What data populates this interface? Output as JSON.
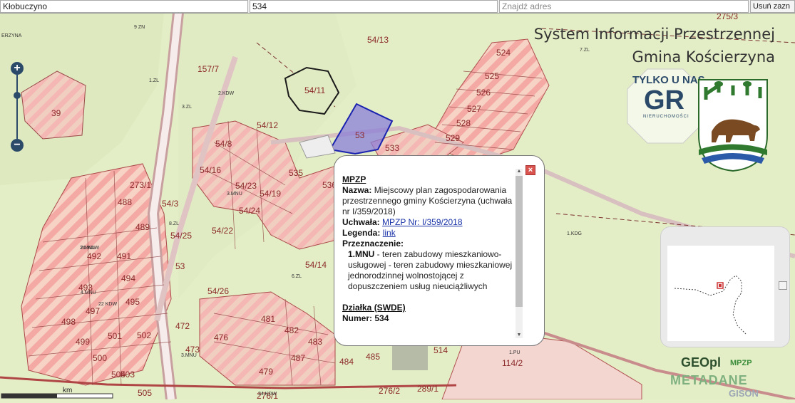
{
  "topbar": {
    "place_value": "Kłobuczyno",
    "number_value": "534",
    "address_placeholder": "Znajdź adres",
    "clear_label": "Usuń zazn"
  },
  "header": {
    "title_line1": "System Informacji Przestrzennej",
    "title_line2": "Gmina Kościerzyna"
  },
  "zoom": {
    "in": "+",
    "out": "−"
  },
  "badge": {
    "top": "TYLKO U NAS",
    "big": "GR",
    "sub": "NIERUCHOMOŚCI"
  },
  "popup": {
    "heading": "MPZP",
    "name_label": "Nazwa:",
    "name_value": "Miejscowy plan zagospodarowania przestrzennego gminy Kościerzyna (uchwała nr I/359/2018)",
    "resolution_label": "Uchwała:",
    "resolution_link": "MPZP Nr: I/359/2018",
    "legend_label": "Legenda:",
    "legend_link": "link",
    "purpose_label": "Przeznaczenie:",
    "purpose_code": "1.MNU",
    "purpose_text": " - teren zabudowy mieszkaniowo-usługowej - teren zabudowy mieszkaniowej jednorodzinnej wolnostojącej z dopuszczeniem usług nieuciążliwych",
    "parcel_heading": "Działka (SWDE)",
    "parcel_partial": "Numer: 534",
    "close": "×"
  },
  "scale": {
    "unit": "km"
  },
  "logos": {
    "geo": "GEOpl",
    "mpzp": "MPZP",
    "meta": "METADANE",
    "gison": "GISON"
  },
  "map_labels": [
    {
      "t": "ERZYNA"
    },
    {
      "t": "9 ZN"
    },
    {
      "t": "54/13"
    },
    {
      "t": "157/7"
    },
    {
      "t": "524"
    },
    {
      "t": "525"
    },
    {
      "t": "526"
    },
    {
      "t": "527"
    },
    {
      "t": "528"
    },
    {
      "t": "529"
    },
    {
      "t": "54/11"
    },
    {
      "t": "39"
    },
    {
      "t": "54/12"
    },
    {
      "t": "53"
    },
    {
      "t": "533"
    },
    {
      "t": "54/8"
    },
    {
      "t": "54/16"
    },
    {
      "t": "535"
    },
    {
      "t": "536"
    },
    {
      "t": "54/23"
    },
    {
      "t": "54/19"
    },
    {
      "t": "273/1"
    },
    {
      "t": "488"
    },
    {
      "t": "54/24"
    },
    {
      "t": "54/3"
    },
    {
      "t": "54/22"
    },
    {
      "t": "54/25"
    },
    {
      "t": "489"
    },
    {
      "t": "492"
    },
    {
      "t": "491"
    },
    {
      "t": "53"
    },
    {
      "t": "54/14"
    },
    {
      "t": "494"
    },
    {
      "t": "493"
    },
    {
      "t": "54/26"
    },
    {
      "t": "497"
    },
    {
      "t": "495"
    },
    {
      "t": "481"
    },
    {
      "t": "498"
    },
    {
      "t": "472"
    },
    {
      "t": "482"
    },
    {
      "t": "499"
    },
    {
      "t": "501"
    },
    {
      "t": "502"
    },
    {
      "t": "476"
    },
    {
      "t": "483"
    },
    {
      "t": "500"
    },
    {
      "t": "473"
    },
    {
      "t": "487"
    },
    {
      "t": "503"
    },
    {
      "t": "484"
    },
    {
      "t": "485"
    },
    {
      "t": "504"
    },
    {
      "t": "479"
    },
    {
      "t": "514"
    },
    {
      "t": "114/2"
    },
    {
      "t": "505"
    },
    {
      "t": "276/1"
    },
    {
      "t": "276/2"
    },
    {
      "t": "289/1"
    },
    {
      "t": "275/3"
    },
    {
      "t": "1.PU"
    },
    {
      "t": "1.KDG"
    },
    {
      "t": "2.KDW"
    },
    {
      "t": "3.ZL"
    },
    {
      "t": "3.MNU"
    },
    {
      "t": "8.ZL"
    },
    {
      "t": "6.ZL"
    },
    {
      "t": "2.MNU"
    },
    {
      "t": "4.MNU"
    },
    {
      "t": "22 KDW"
    },
    {
      "t": "20 KDW"
    },
    {
      "t": "24 KDW"
    },
    {
      "t": "7.ZL"
    },
    {
      "t": "1.ZL"
    },
    {
      "t": "3.MNU"
    }
  ]
}
